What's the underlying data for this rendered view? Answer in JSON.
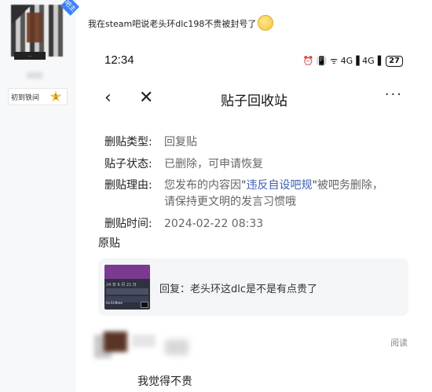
{
  "user": {
    "avatar_caption": "...",
    "badge": "吧主",
    "level_name": "初到铁间",
    "level_num": "1"
  },
  "post": {
    "title": "我在steam吧说老头环dlc198不贵被封号了"
  },
  "phone": {
    "time": "12:34",
    "status_icons": "⏰ 📳 ᯤ 4G▐ 4G▐",
    "battery": "27"
  },
  "navbar": {
    "back_icon": "‹",
    "close_icon": "✕",
    "title": "贴子回收站",
    "more_icon": "···"
  },
  "info": {
    "type_label": "删贴类型:",
    "type_value": "回复贴",
    "status_label": "贴子状态:",
    "status_value": "已删除，可申请恢复",
    "reason_label": "删贴理由:",
    "reason_prefix": "您发布的内容因",
    "reason_link": "违反自设吧规",
    "reason_suffix": "被吧务删除，",
    "reason_line2": "请保持更文明的发言习惯哦",
    "time_label": "删贴时间:",
    "time_value": "2024-02-22 08:33"
  },
  "original": {
    "label": "原贴",
    "thumb_date": "24 年 6 月 21 日",
    "thumb_text": "he Erdtree",
    "text": "回复：老头环这dlc是不是有点贵了"
  },
  "comment": {
    "read_label": "阅读",
    "reply_text": "我觉得不贵"
  }
}
